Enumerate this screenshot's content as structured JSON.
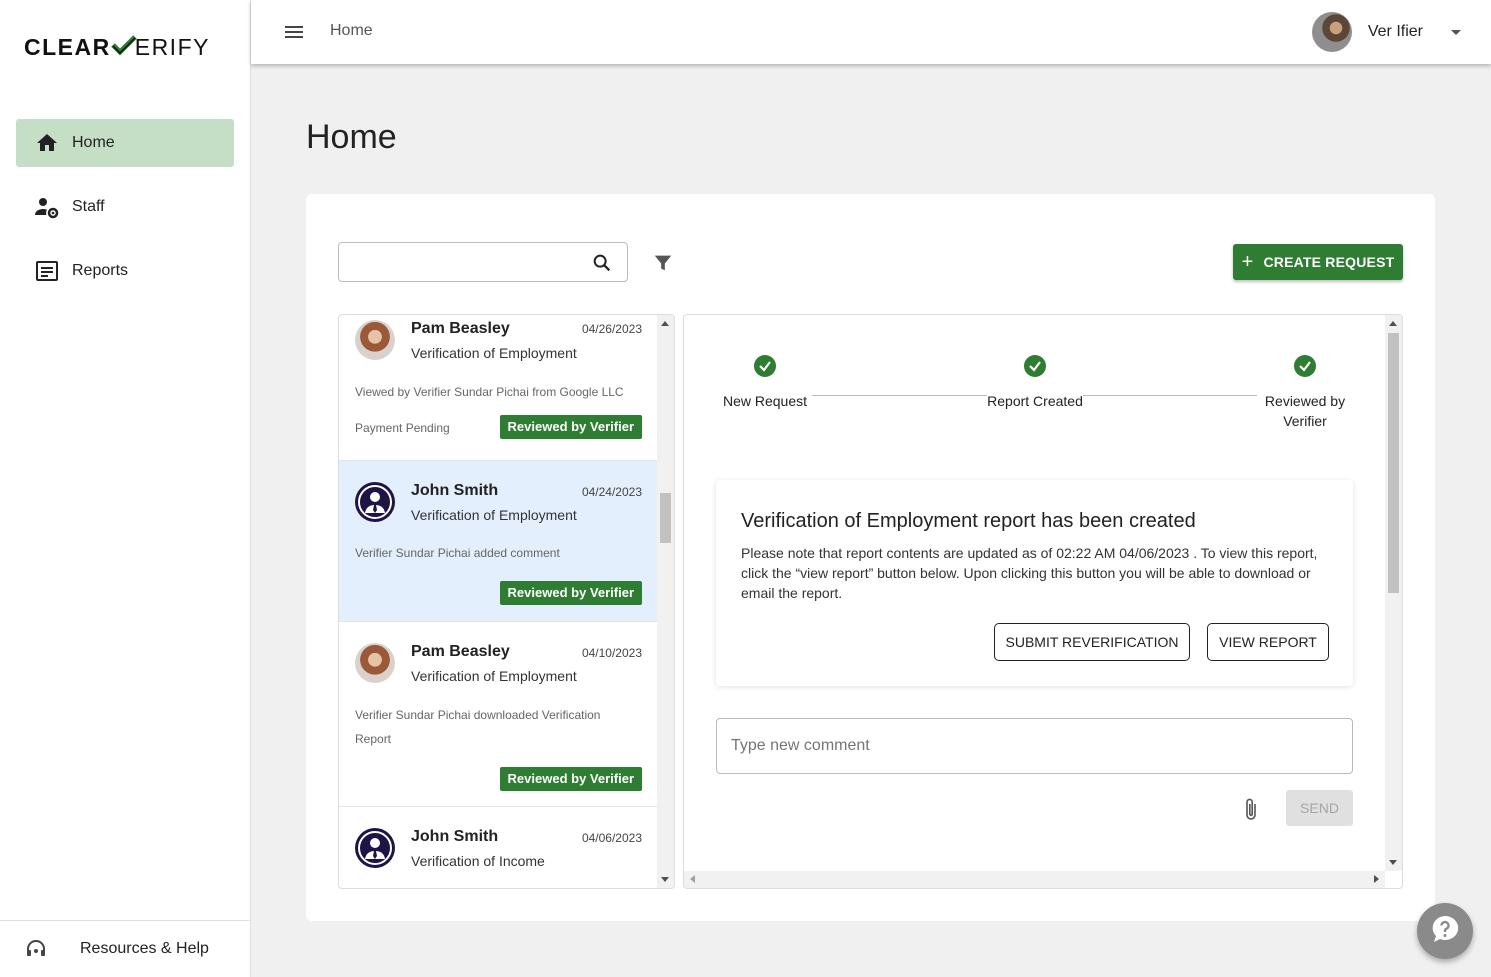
{
  "brand": {
    "part1": "CLEAR",
    "part2": "ERIFY",
    "accent": "#2e7d32"
  },
  "sidebar": {
    "items": [
      {
        "label": "Home",
        "icon": "home-icon",
        "active": true
      },
      {
        "label": "Staff",
        "icon": "staff-settings-icon",
        "active": false
      },
      {
        "label": "Reports",
        "icon": "reports-icon",
        "active": false
      }
    ],
    "help": {
      "label": "Resources & Help",
      "icon": "headset-icon"
    }
  },
  "topbar": {
    "breadcrumb": "Home",
    "user_name": "Ver Ifier"
  },
  "page": {
    "title": "Home"
  },
  "toolbar": {
    "search_placeholder": "",
    "create_label": "CREATE REQUEST"
  },
  "requests": [
    {
      "name": "Pam Beasley",
      "date": "04/26/2023",
      "type": "Verification of Employment",
      "note": "Viewed by Verifier Sundar Pichai from Google LLC",
      "payment": "Payment Pending",
      "status": "Reviewed by Verifier",
      "avatar": "photo"
    },
    {
      "name": "John Smith",
      "date": "04/24/2023",
      "type": "Verification of Employment",
      "note": "Verifier Sundar Pichai added comment",
      "payment": "",
      "status": "Reviewed by Verifier",
      "avatar": "person-icon"
    },
    {
      "name": "Pam Beasley",
      "date": "04/10/2023",
      "type": "Verification of Employment",
      "note": "Verifier Sundar Pichai downloaded Verification Report",
      "payment": "",
      "status": "Reviewed by Verifier",
      "avatar": "photo"
    },
    {
      "name": "John Smith",
      "date": "04/06/2023",
      "type": "Verification of Income",
      "note": "",
      "payment": "",
      "status": "",
      "avatar": "person-icon"
    }
  ],
  "detail": {
    "steps": [
      {
        "label": "New Request"
      },
      {
        "label": "Report Created"
      },
      {
        "label": "Reviewed by Verifier"
      }
    ],
    "notice_title": "Verification of Employment report has been created",
    "notice_text": "Please note that report contents are updated as of 02:22 AM 04/06/2023 . To view this report, click the “view report” button below. Upon clicking this button you will be able to download or email the report.",
    "resubmit_label": "SUBMIT REVERIFICATION",
    "view_label": "VIEW REPORT",
    "comment_placeholder": "Type new comment",
    "send_label": "SEND"
  },
  "fab": {
    "icon": "help-question-icon"
  }
}
